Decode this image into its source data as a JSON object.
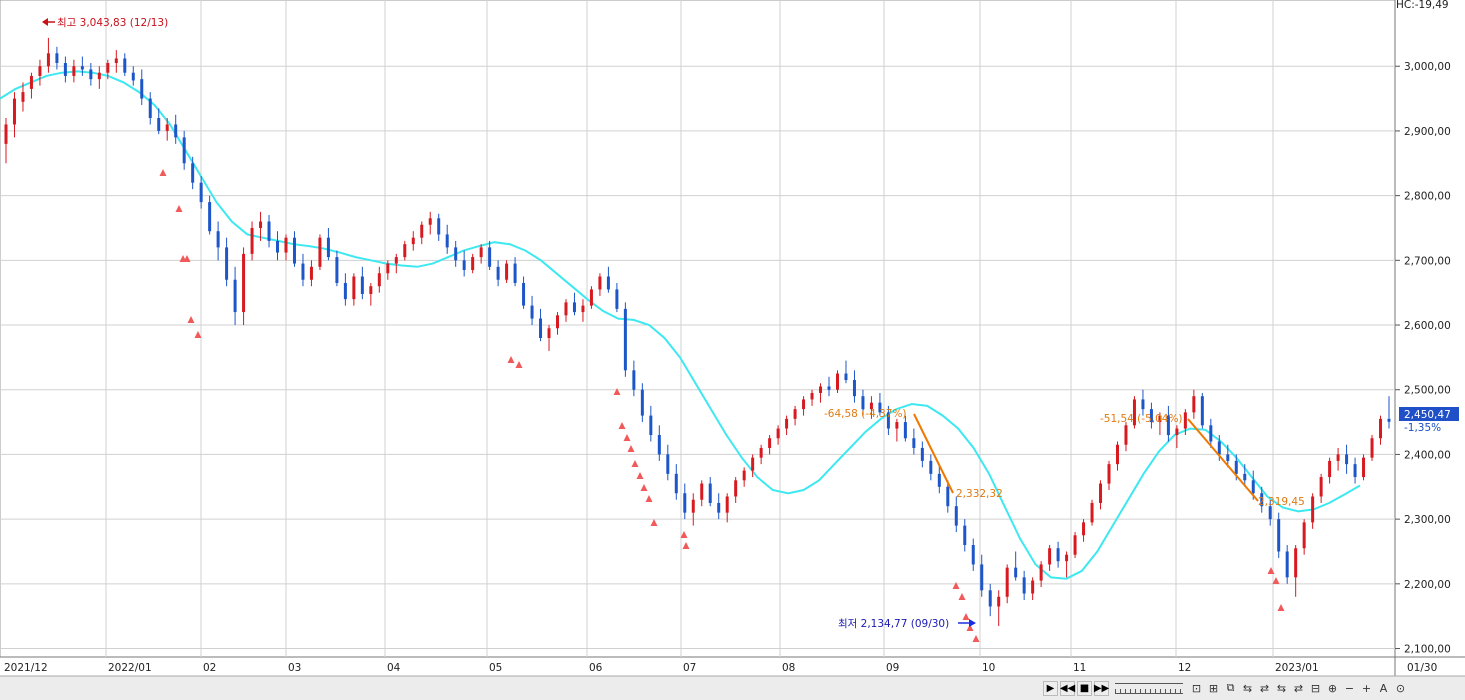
{
  "chart_data": {
    "type": "candlestick",
    "y_axis": {
      "ticks": [
        "3,000,00",
        "2,900,00",
        "2,800,00",
        "2,700,00",
        "2,600,00",
        "2,500,00",
        "2,400,00",
        "2,300,00",
        "2,200,00",
        "2,100,00"
      ],
      "range": [
        2090,
        3090
      ],
      "top_label": "HC:-19,49"
    },
    "x_axis": {
      "ticks": [
        "2021/12",
        "2022/01",
        "02",
        "03",
        "04",
        "05",
        "06",
        "07",
        "08",
        "09",
        "10",
        "11",
        "12",
        "2023/01",
        "01/30"
      ]
    },
    "candles": [
      [
        2880,
        2920,
        2850,
        2910
      ],
      [
        2910,
        2960,
        2890,
        2950
      ],
      [
        2945,
        2975,
        2930,
        2960
      ],
      [
        2965,
        2990,
        2950,
        2985
      ],
      [
        2985,
        3010,
        2970,
        3000
      ],
      [
        3000,
        3043.83,
        2990,
        3020
      ],
      [
        3020,
        3030,
        2995,
        3005
      ],
      [
        3005,
        3015,
        2975,
        2985
      ],
      [
        2985,
        3010,
        2975,
        3000
      ],
      [
        3000,
        3015,
        2985,
        2995
      ],
      [
        2995,
        3005,
        2970,
        2980
      ],
      [
        2980,
        3000,
        2965,
        2990
      ],
      [
        2990,
        3010,
        2980,
        3005
      ],
      [
        3005,
        3025,
        2990,
        3012
      ],
      [
        3012,
        3020,
        2985,
        2990
      ],
      [
        2990,
        3000,
        2970,
        2978
      ],
      [
        2980,
        2995,
        2940,
        2950
      ],
      [
        2950,
        2960,
        2910,
        2920
      ],
      [
        2920,
        2935,
        2895,
        2900
      ],
      [
        2900,
        2920,
        2885,
        2910
      ],
      [
        2910,
        2925,
        2880,
        2890
      ],
      [
        2890,
        2900,
        2840,
        2850
      ],
      [
        2850,
        2860,
        2810,
        2820
      ],
      [
        2820,
        2830,
        2780,
        2790
      ],
      [
        2790,
        2800,
        2740,
        2745
      ],
      [
        2745,
        2760,
        2700,
        2720
      ],
      [
        2720,
        2735,
        2660,
        2670
      ],
      [
        2670,
        2690,
        2600,
        2620
      ],
      [
        2620,
        2720,
        2600,
        2710
      ],
      [
        2710,
        2760,
        2700,
        2750
      ],
      [
        2750,
        2775,
        2730,
        2760
      ],
      [
        2760,
        2770,
        2720,
        2730
      ],
      [
        2730,
        2745,
        2700,
        2712
      ],
      [
        2712,
        2740,
        2700,
        2735
      ],
      [
        2735,
        2745,
        2690,
        2695
      ],
      [
        2695,
        2710,
        2660,
        2670
      ],
      [
        2670,
        2700,
        2660,
        2690
      ],
      [
        2690,
        2740,
        2685,
        2735
      ],
      [
        2735,
        2750,
        2700,
        2705
      ],
      [
        2705,
        2715,
        2660,
        2665
      ],
      [
        2665,
        2680,
        2630,
        2640
      ],
      [
        2640,
        2680,
        2630,
        2675
      ],
      [
        2675,
        2690,
        2640,
        2648
      ],
      [
        2648,
        2665,
        2630,
        2660
      ],
      [
        2660,
        2690,
        2650,
        2680
      ],
      [
        2680,
        2700,
        2670,
        2695
      ],
      [
        2695,
        2710,
        2680,
        2705
      ],
      [
        2705,
        2730,
        2700,
        2725
      ],
      [
        2725,
        2745,
        2715,
        2735
      ],
      [
        2735,
        2760,
        2725,
        2755
      ],
      [
        2755,
        2775,
        2740,
        2765
      ],
      [
        2765,
        2772,
        2730,
        2740
      ],
      [
        2740,
        2755,
        2710,
        2720
      ],
      [
        2720,
        2730,
        2690,
        2700
      ],
      [
        2700,
        2715,
        2675,
        2685
      ],
      [
        2685,
        2710,
        2680,
        2705
      ],
      [
        2705,
        2725,
        2695,
        2720
      ],
      [
        2720,
        2730,
        2685,
        2690
      ],
      [
        2690,
        2700,
        2660,
        2670
      ],
      [
        2670,
        2700,
        2665,
        2695
      ],
      [
        2695,
        2705,
        2660,
        2665
      ],
      [
        2665,
        2675,
        2625,
        2630
      ],
      [
        2630,
        2645,
        2600,
        2610
      ],
      [
        2610,
        2625,
        2575,
        2580
      ],
      [
        2580,
        2600,
        2560,
        2595
      ],
      [
        2595,
        2620,
        2585,
        2615
      ],
      [
        2615,
        2640,
        2605,
        2635
      ],
      [
        2635,
        2650,
        2615,
        2620
      ],
      [
        2620,
        2640,
        2605,
        2630
      ],
      [
        2630,
        2660,
        2625,
        2655
      ],
      [
        2655,
        2680,
        2645,
        2675
      ],
      [
        2675,
        2690,
        2650,
        2655
      ],
      [
        2655,
        2665,
        2620,
        2625
      ],
      [
        2625,
        2635,
        2520,
        2530
      ],
      [
        2530,
        2545,
        2490,
        2500
      ],
      [
        2500,
        2510,
        2450,
        2460
      ],
      [
        2460,
        2475,
        2420,
        2430
      ],
      [
        2430,
        2445,
        2390,
        2400
      ],
      [
        2400,
        2415,
        2360,
        2370
      ],
      [
        2370,
        2385,
        2330,
        2340
      ],
      [
        2340,
        2355,
        2300,
        2310
      ],
      [
        2310,
        2340,
        2290,
        2330
      ],
      [
        2330,
        2360,
        2320,
        2355
      ],
      [
        2355,
        2365,
        2320,
        2325
      ],
      [
        2325,
        2340,
        2300,
        2310
      ],
      [
        2310,
        2340,
        2295,
        2335
      ],
      [
        2335,
        2365,
        2325,
        2360
      ],
      [
        2360,
        2380,
        2350,
        2375
      ],
      [
        2375,
        2400,
        2365,
        2395
      ],
      [
        2395,
        2415,
        2385,
        2410
      ],
      [
        2410,
        2430,
        2400,
        2425
      ],
      [
        2425,
        2445,
        2415,
        2440
      ],
      [
        2440,
        2460,
        2430,
        2455
      ],
      [
        2455,
        2475,
        2445,
        2470
      ],
      [
        2470,
        2490,
        2460,
        2485
      ],
      [
        2485,
        2500,
        2475,
        2495
      ],
      [
        2495,
        2510,
        2480,
        2505
      ],
      [
        2505,
        2520,
        2490,
        2500
      ],
      [
        2500,
        2530,
        2495,
        2525
      ],
      [
        2525,
        2545,
        2510,
        2515
      ],
      [
        2515,
        2530,
        2480,
        2490
      ],
      [
        2490,
        2500,
        2460,
        2470
      ],
      [
        2470,
        2490,
        2455,
        2480
      ],
      [
        2480,
        2495,
        2460,
        2465
      ],
      [
        2465,
        2475,
        2430,
        2440
      ],
      [
        2440,
        2455,
        2420,
        2450
      ],
      [
        2450,
        2460,
        2420,
        2425
      ],
      [
        2425,
        2440,
        2400,
        2410
      ],
      [
        2410,
        2420,
        2380,
        2390
      ],
      [
        2390,
        2400,
        2360,
        2370
      ],
      [
        2370,
        2385,
        2340,
        2350
      ],
      [
        2350,
        2360,
        2310,
        2320
      ],
      [
        2320,
        2335,
        2280,
        2290
      ],
      [
        2290,
        2300,
        2250,
        2260
      ],
      [
        2260,
        2270,
        2220,
        2230
      ],
      [
        2230,
        2245,
        2180,
        2190
      ],
      [
        2190,
        2200,
        2150,
        2165
      ],
      [
        2165,
        2190,
        2134.77,
        2180
      ],
      [
        2180,
        2230,
        2170,
        2225
      ],
      [
        2225,
        2250,
        2205,
        2210
      ],
      [
        2210,
        2220,
        2175,
        2185
      ],
      [
        2185,
        2210,
        2175,
        2205
      ],
      [
        2205,
        2235,
        2195,
        2230
      ],
      [
        2230,
        2260,
        2220,
        2255
      ],
      [
        2255,
        2265,
        2225,
        2235
      ],
      [
        2235,
        2250,
        2210,
        2245
      ],
      [
        2245,
        2280,
        2240,
        2275
      ],
      [
        2275,
        2300,
        2265,
        2295
      ],
      [
        2295,
        2330,
        2290,
        2325
      ],
      [
        2325,
        2360,
        2315,
        2355
      ],
      [
        2355,
        2390,
        2345,
        2385
      ],
      [
        2385,
        2420,
        2375,
        2415
      ],
      [
        2415,
        2450,
        2405,
        2445
      ],
      [
        2445,
        2490,
        2440,
        2485
      ],
      [
        2485,
        2500,
        2460,
        2470
      ],
      [
        2470,
        2480,
        2440,
        2450
      ],
      [
        2450,
        2465,
        2430,
        2460
      ],
      [
        2460,
        2475,
        2420,
        2430
      ],
      [
        2430,
        2445,
        2410,
        2440
      ],
      [
        2440,
        2470,
        2430,
        2465
      ],
      [
        2465,
        2500,
        2455,
        2490
      ],
      [
        2490,
        2495,
        2440,
        2445
      ],
      [
        2445,
        2455,
        2410,
        2420
      ],
      [
        2420,
        2430,
        2390,
        2400
      ],
      [
        2400,
        2415,
        2380,
        2390
      ],
      [
        2390,
        2400,
        2360,
        2370
      ],
      [
        2370,
        2385,
        2350,
        2360
      ],
      [
        2360,
        2375,
        2330,
        2340
      ],
      [
        2340,
        2350,
        2310,
        2320
      ],
      [
        2320,
        2330,
        2290,
        2300
      ],
      [
        2300,
        2310,
        2240,
        2250
      ],
      [
        2250,
        2260,
        2200,
        2210
      ],
      [
        2210,
        2260,
        2180,
        2255
      ],
      [
        2255,
        2300,
        2245,
        2295
      ],
      [
        2295,
        2340,
        2285,
        2335
      ],
      [
        2335,
        2370,
        2325,
        2365
      ],
      [
        2365,
        2395,
        2355,
        2390
      ],
      [
        2390,
        2410,
        2375,
        2400
      ],
      [
        2400,
        2415,
        2370,
        2385
      ],
      [
        2385,
        2395,
        2355,
        2365
      ],
      [
        2365,
        2400,
        2360,
        2395
      ],
      [
        2395,
        2430,
        2390,
        2425
      ],
      [
        2425,
        2460,
        2415,
        2455
      ],
      [
        2455,
        2490,
        2440,
        2450.47
      ]
    ],
    "moving_average": [
      2950,
      2965,
      2975,
      2985,
      2990,
      2992,
      2990,
      2985,
      2975,
      2960,
      2940,
      2910,
      2870,
      2830,
      2790,
      2760,
      2740,
      2735,
      2730,
      2725,
      2722,
      2718,
      2712,
      2705,
      2700,
      2695,
      2692,
      2690,
      2695,
      2705,
      2715,
      2722,
      2728,
      2725,
      2715,
      2700,
      2680,
      2660,
      2640,
      2622,
      2610,
      2608,
      2600,
      2580,
      2550,
      2510,
      2470,
      2430,
      2395,
      2365,
      2345,
      2340,
      2345,
      2360,
      2385,
      2410,
      2435,
      2455,
      2470,
      2478,
      2475,
      2460,
      2440,
      2410,
      2370,
      2320,
      2270,
      2230,
      2210,
      2208,
      2220,
      2250,
      2290,
      2330,
      2370,
      2405,
      2430,
      2440,
      2438,
      2420,
      2395,
      2365,
      2335,
      2318,
      2312,
      2315,
      2325,
      2338,
      2352
    ],
    "annotations": {
      "high_label": "최고 3,043,83 (12/13)",
      "low_label": "최저 2,134,77 (09/30)",
      "drop1_label": "-64,58 (-4,37%)",
      "drop1_end_label": "2,332,32",
      "drop2_label": "-51,54 (-5,04%)",
      "drop2_end_label": "2,319,45",
      "current_value": "2,450,47",
      "current_change": "-1,35%"
    },
    "colors": {
      "up": "#d71920",
      "down": "#1c56c8",
      "ma": "#3ee8f0",
      "trend": "#f07800",
      "marker": "#f05a5a",
      "price_box": "#2050c8"
    }
  },
  "toolbar": {
    "nav_buttons": [
      "▶",
      "◀◀",
      "■",
      "▶▶"
    ],
    "icons": [
      "⊡",
      "⊞",
      "⧉",
      "⇆",
      "⇄",
      "⇆",
      "⇄",
      "⊟",
      "⊕",
      "−",
      "+",
      "A",
      "⊙"
    ]
  }
}
